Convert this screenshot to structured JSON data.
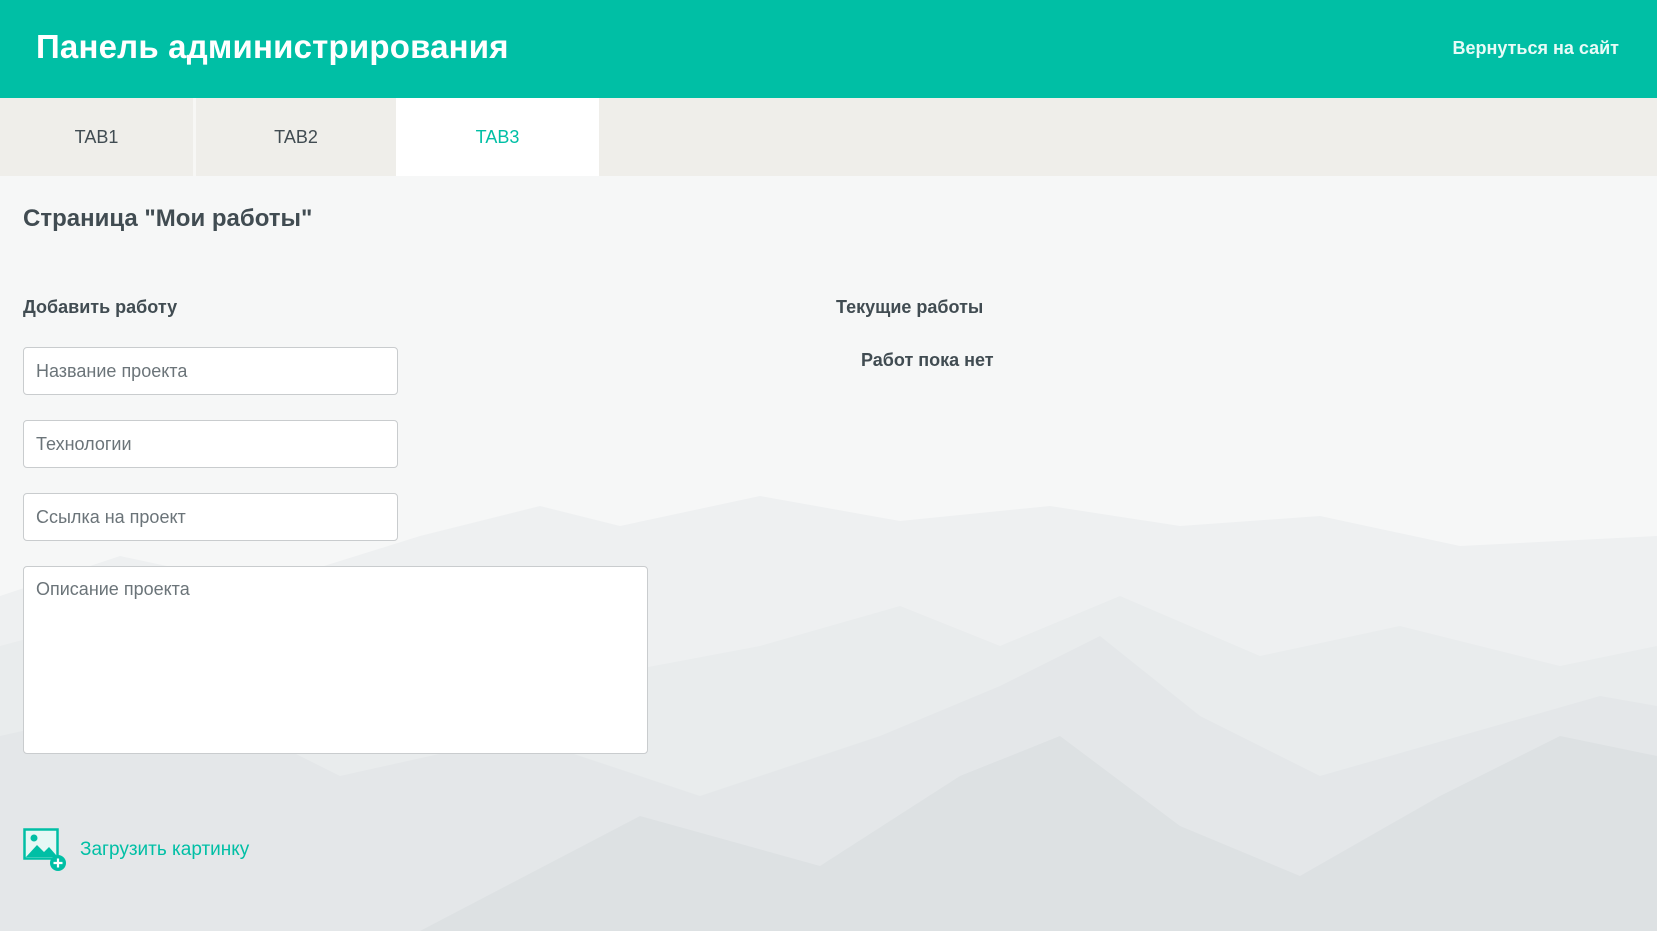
{
  "header": {
    "title": "Панель администрирования",
    "back_link": "Вернуться на сайт"
  },
  "tabs": [
    {
      "label": "TAB1",
      "active": false
    },
    {
      "label": "TAB2",
      "active": false
    },
    {
      "label": "TAB3",
      "active": true
    }
  ],
  "page": {
    "title": "Страница \"Мои работы\""
  },
  "add_work": {
    "title": "Добавить работу",
    "project_name_placeholder": "Название проекта",
    "technologies_placeholder": "Технологии",
    "project_link_placeholder": "Ссылка на проект",
    "description_placeholder": "Описание проекта",
    "upload_label": "Загрузить картинку",
    "upload_icon": "image-add-icon"
  },
  "current_works": {
    "title": "Текущие работы",
    "empty_text": "Работ пока нет"
  },
  "colors": {
    "accent": "#00bfa5",
    "tab_bar": "#efeeea",
    "text": "#414c52"
  }
}
